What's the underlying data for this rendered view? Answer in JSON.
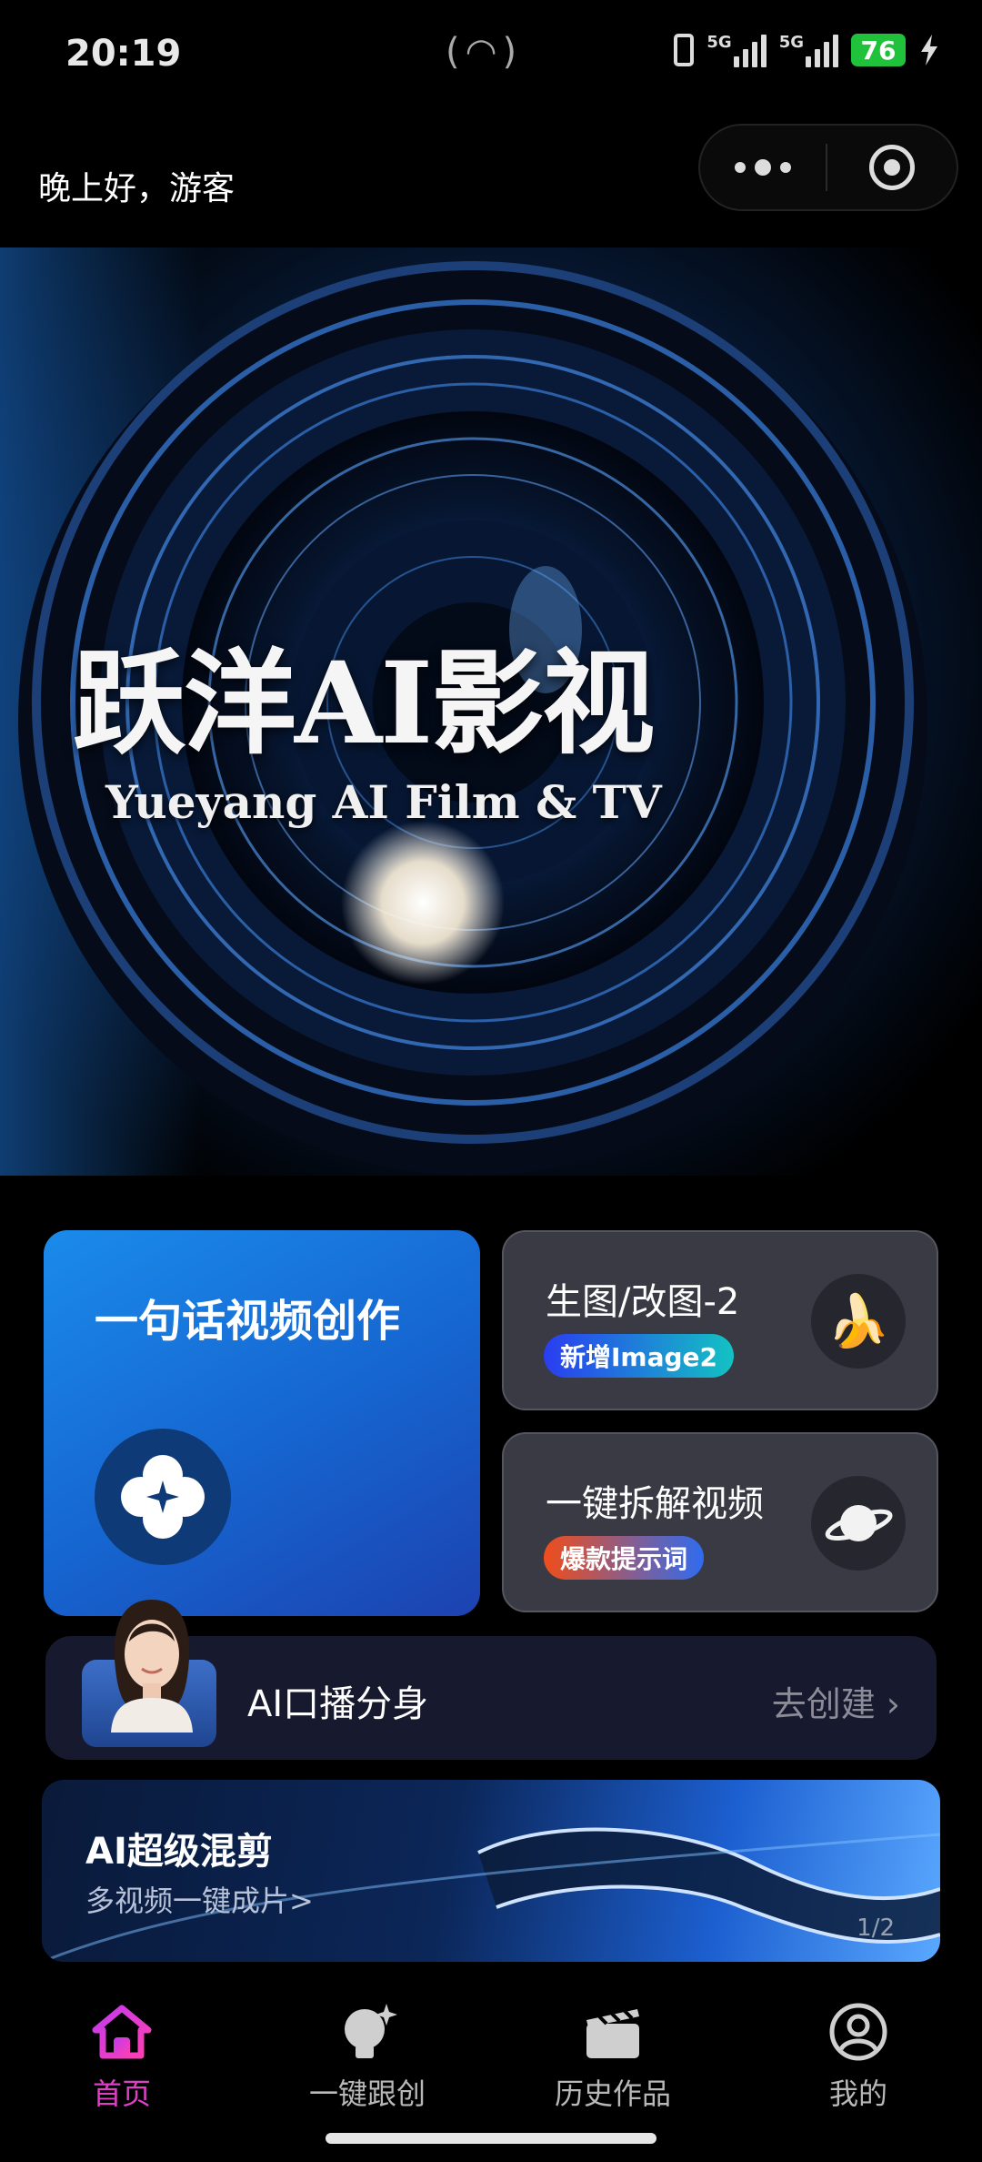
{
  "status_bar": {
    "time": "20:19",
    "hotspot_icon": "hotspot-icon",
    "sim1": "5G",
    "sim2": "5G",
    "battery": "76"
  },
  "header": {
    "greeting": "晚上好，游客",
    "capsule_more_icon": "more-dots-icon",
    "capsule_close_icon": "target-icon"
  },
  "banner": {
    "title": "跃洋AI影视",
    "subtitle": "Yueyang AI Film & TV"
  },
  "cards": {
    "video": {
      "title": "一句话视频创作",
      "icon": "sparkle-flower-icon"
    },
    "image": {
      "title": "生图/改图-2",
      "tag": "新增Image2",
      "icon": "banana-icon"
    },
    "split": {
      "title": "一键拆解视频",
      "tag": "爆款提示词",
      "icon": "planet-icon"
    }
  },
  "avatar_bar": {
    "label": "AI口播分身",
    "action": "去创建 ›"
  },
  "mix_banner": {
    "title": "AI超级混剪",
    "subtitle": "多视频一键成片>",
    "pager": "1/2"
  },
  "tabs": [
    {
      "label": "首页",
      "icon": "home-icon",
      "active": true
    },
    {
      "label": "一键跟创",
      "icon": "bulb-sparkle-icon",
      "active": false
    },
    {
      "label": "历史作品",
      "icon": "clapperboard-icon",
      "active": false
    },
    {
      "label": "我的",
      "icon": "user-icon",
      "active": false
    }
  ],
  "colors": {
    "accent": "#e040c8",
    "video_card": "#1664cf",
    "tag_image": "#1f4fe0",
    "tag_split": "#f05a1e"
  }
}
